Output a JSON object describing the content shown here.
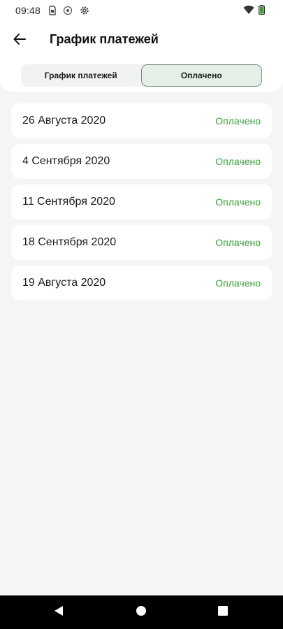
{
  "status_bar": {
    "time": "09:48",
    "icons_left": [
      "sim-icon",
      "nfc-icon",
      "settings-icon"
    ],
    "icons_right": [
      "wifi-icon",
      "battery-icon"
    ]
  },
  "header": {
    "title": "График платежей",
    "back_icon": "arrow-left-icon"
  },
  "tabs": [
    {
      "label": "График платежей",
      "active": false
    },
    {
      "label": "Оплачено",
      "active": true
    }
  ],
  "payments": [
    {
      "date": "26 Августа 2020",
      "status": "Оплачено"
    },
    {
      "date": "4 Сентября 2020",
      "status": "Оплачено"
    },
    {
      "date": "11 Сентября 2020",
      "status": "Оплачено"
    },
    {
      "date": "18 Сентября 2020",
      "status": "Оплачено"
    },
    {
      "date": "19 Августа 2020",
      "status": "Оплачено"
    }
  ],
  "colors": {
    "status_paid": "#3c9d3f",
    "active_tab_bg": "#e5efe6",
    "background": "#f4f5f7"
  },
  "nav_bar": {
    "buttons": [
      "back-triangle-icon",
      "home-circle-icon",
      "recents-square-icon"
    ]
  }
}
